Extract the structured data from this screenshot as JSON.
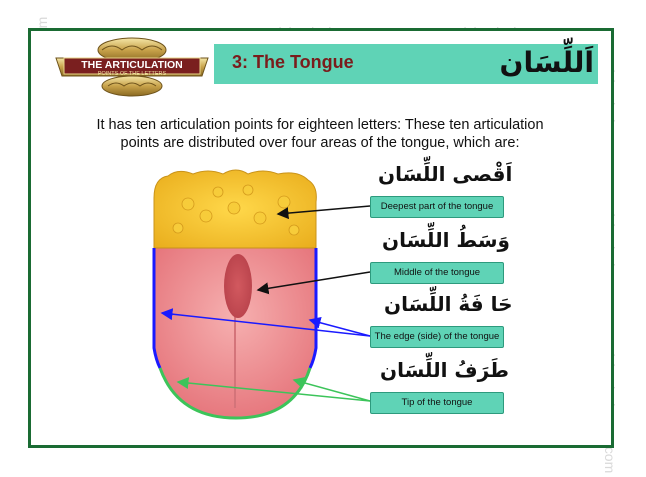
{
  "watermark": "www.islamicclasses.com",
  "badge": {
    "line1": "THE ARTICULATION",
    "line2": "POINTS OF THE LETTERS"
  },
  "header": {
    "title": "3: The Tongue",
    "arabic_title": "اَللِّسَان"
  },
  "intro": {
    "line1": "It has ten articulation points for eighteen letters: These ten articulation",
    "line2": "points are distributed over four areas of the tongue, which are:"
  },
  "areas": [
    {
      "arabic": "اَقْصى اللِّسَان",
      "label": "Deepest part of the tongue"
    },
    {
      "arabic": "وَسَطُ اللِّسَان",
      "label": "Middle of the tongue"
    },
    {
      "arabic": "حَا فَةُ اللِّسَان",
      "label": "The edge (side) of the tongue"
    },
    {
      "arabic": "طَرَفُ اللِّسَان",
      "label": "Tip of the tongue"
    }
  ],
  "colors": {
    "frame": "#1a6b33",
    "header_bg": "#5fd3b6",
    "deepest": "#f2c52e",
    "middle": "#e8868a",
    "edge_line": "#1a1aff",
    "tip_line": "#3cc45a"
  }
}
